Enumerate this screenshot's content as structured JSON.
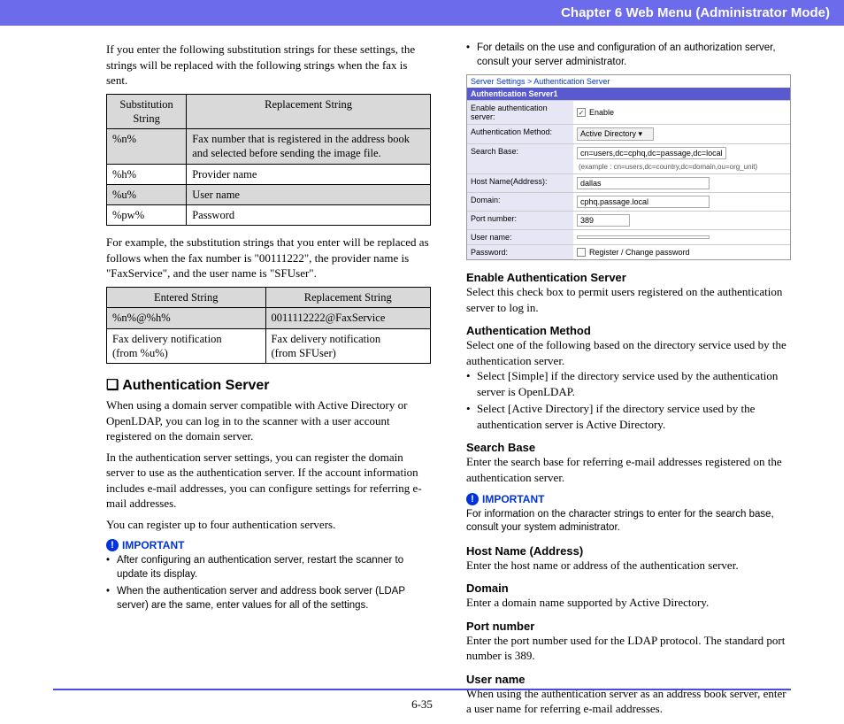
{
  "header": {
    "chapter": "Chapter 6   Web Menu (Administrator Mode)"
  },
  "left": {
    "intro1": "If you enter the following substitution strings for these settings, the strings will be replaced with the following strings when the fax is sent.",
    "table1": {
      "h1": "Substitution String",
      "h2": "Replacement String",
      "rows": [
        {
          "c1": "%n%",
          "c2": "Fax number that is registered in the address book and selected before sending the image file."
        },
        {
          "c1": "%h%",
          "c2": "Provider name"
        },
        {
          "c1": "%u%",
          "c2": "User name"
        },
        {
          "c1": "%pw%",
          "c2": "Password"
        }
      ]
    },
    "intro2": "For example, the substitution strings that you enter will be replaced as follows when the fax number is \"00111222\", the provider name is \"FaxService\", and the user name is \"SFUser\".",
    "table2": {
      "h1": "Entered String",
      "h2": "Replacement String",
      "rows": [
        {
          "c1": "%n%@%h%",
          "c2": "0011112222@FaxService"
        },
        {
          "c1": "Fax delivery notification\n(from %u%)",
          "c2": "Fax delivery notification\n(from SFUser)"
        }
      ]
    },
    "auth_head": "Authentication Server",
    "auth_p1": "When using a domain server compatible with Active Directory or OpenLDAP, you can log in to the scanner with a user account registered on the domain server.",
    "auth_p2": "In the authentication server settings, you can register the domain server to use as the authentication server. If the account information includes e-mail addresses, you can configure settings for referring e-mail addresses.",
    "auth_p3": "You can register up to four authentication servers.",
    "important": "IMPORTANT",
    "imp_b1": "After configuring an authentication server, restart the scanner to update its display.",
    "imp_b2": "When the authentication server and address book server (LDAP server) are the same, enter values for all of the settings."
  },
  "right": {
    "top_b1": "For details on the use and configuration of an authorization server, consult your server administrator.",
    "screenshot": {
      "crumb": "Server Settings > Authentication Server",
      "bar": "Authentication Server1",
      "rows": [
        {
          "lab": "Enable authentication server:",
          "type": "check",
          "val": "Enable"
        },
        {
          "lab": "Authentication Method:",
          "type": "select",
          "val": "Active Directory"
        },
        {
          "lab": "Search Base:",
          "type": "input",
          "val": "cn=users,dc=cphq,dc=passage,dc=local",
          "hint": "(example : cn=users,dc=country,dc=domain,ou=org_unit)"
        },
        {
          "lab": "Host Name(Address):",
          "type": "input",
          "val": "dallas"
        },
        {
          "lab": "Domain:",
          "type": "input",
          "val": "cphq.passage.local"
        },
        {
          "lab": "Port number:",
          "type": "input",
          "val": "389"
        },
        {
          "lab": "User name:",
          "type": "input",
          "val": ""
        },
        {
          "lab": "Password:",
          "type": "check-text",
          "val": "Register / Change password"
        }
      ]
    },
    "fields": [
      {
        "h": "Enable Authentication Server",
        "b": "Select this check box to permit users registered on the authentication server to log in."
      },
      {
        "h": "Authentication Method",
        "b": "Select one of the following based on the directory service used by the authentication server.",
        "bul": [
          "Select [Simple] if the directory service used by the authentication server is OpenLDAP.",
          "Select [Active Directory] if the directory service used by the authentication server is Active Directory."
        ]
      },
      {
        "h": "Search Base",
        "b": "Enter the search base for referring e-mail addresses registered on the authentication server.",
        "imp": "For information on the character strings to enter for the search base, consult your system administrator."
      },
      {
        "h": "Host Name (Address)",
        "b": "Enter the host name or address of the authentication server."
      },
      {
        "h": "Domain",
        "b": "Enter a domain name supported by Active Directory."
      },
      {
        "h": "Port number",
        "b": "Enter the port number used for the LDAP protocol. The standard port number is 389."
      },
      {
        "h": "User name",
        "b": "When using the authentication server as an address book server, enter a user name for referring e-mail addresses."
      }
    ],
    "important": "IMPORTANT"
  },
  "footer": {
    "page": "6-35"
  }
}
